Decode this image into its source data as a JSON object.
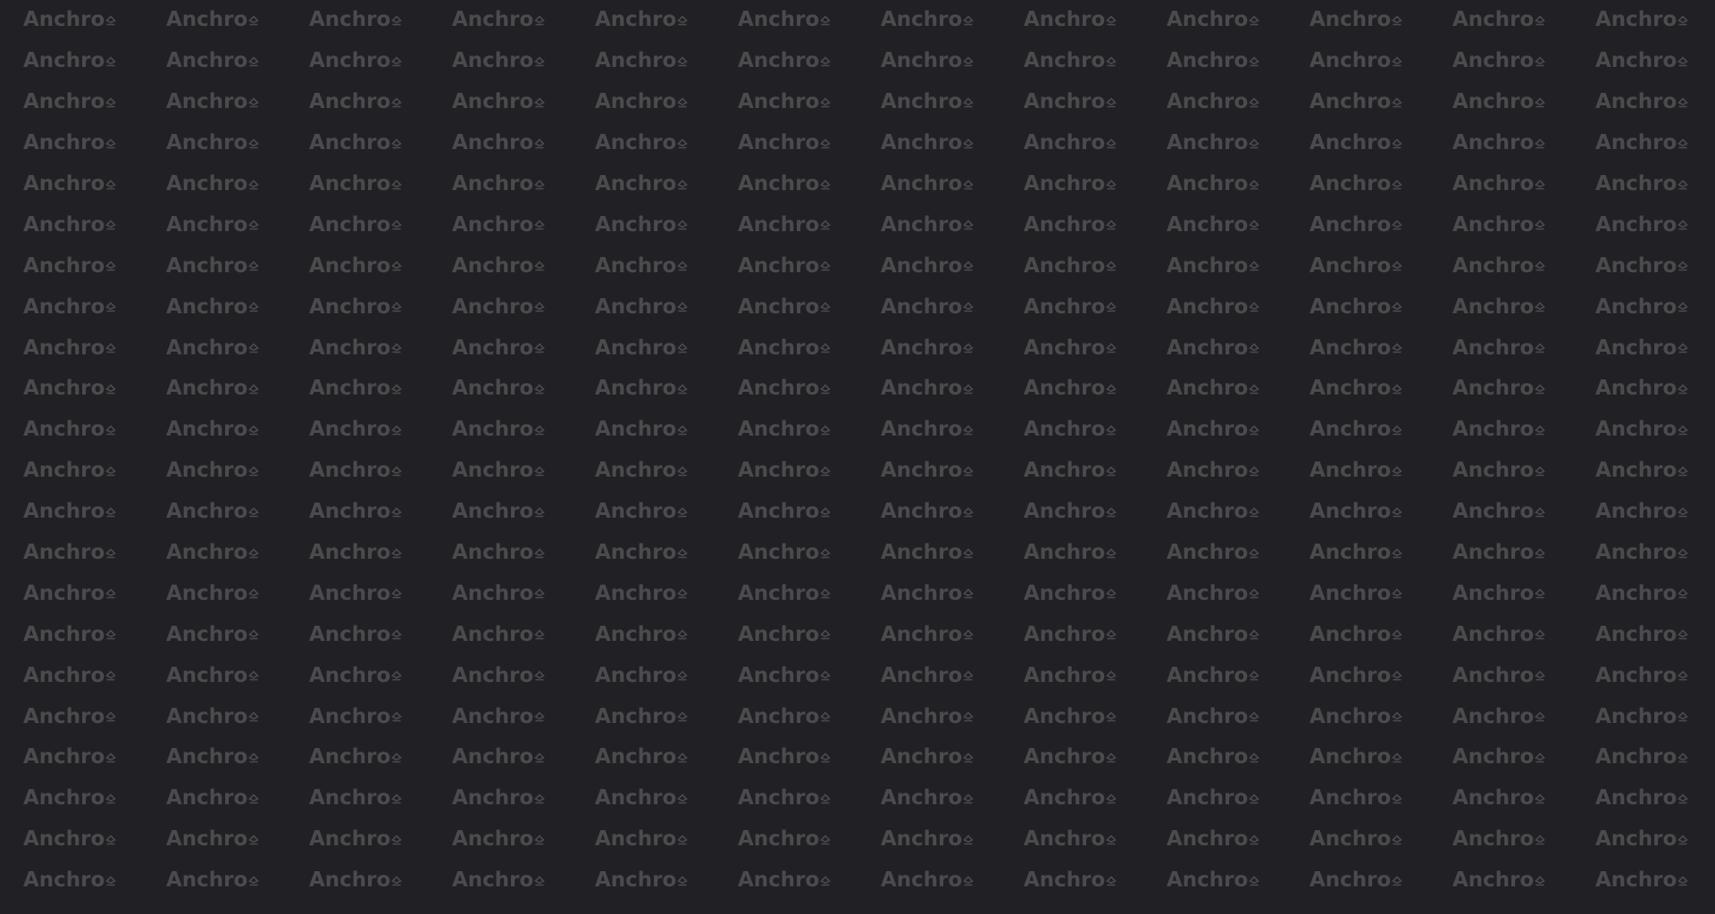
{
  "background_color": "#212024",
  "watermark": {
    "word": "Anchro",
    "icon_name": "anchor-logo-icon",
    "color": "#4b4b4e",
    "columns": 12,
    "rows": 22
  }
}
